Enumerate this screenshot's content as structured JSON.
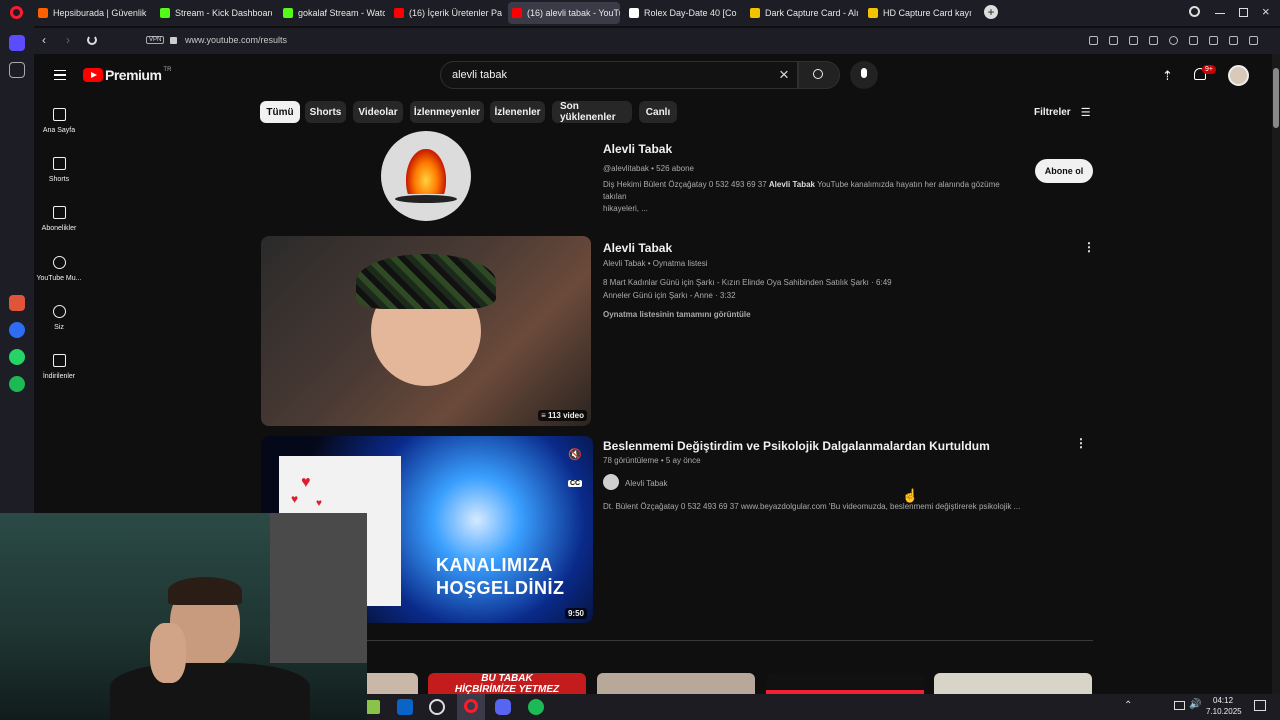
{
  "browser": {
    "tabs": [
      {
        "label": "Hepsiburada | Güvenlik",
        "color": "#ff6000"
      },
      {
        "label": "Stream - Kick Dashboard",
        "color": "#53fc18"
      },
      {
        "label": "gokalaf Stream - Watch L",
        "color": "#53fc18"
      },
      {
        "label": "(16) İçerik Üretenler Paran",
        "color": "#ff0000"
      },
      {
        "label": "(16) alevli tabak - YouTub",
        "color": "#ff0000"
      },
      {
        "label": "Rolex Day-Date 40 [Comp",
        "color": "#ffffff"
      },
      {
        "label": "Dark Capture Card - Alışv",
        "color": "#f5c400"
      },
      {
        "label": "HD Capture Card kayıt ka",
        "color": "#f5c400"
      }
    ],
    "vpn_label": "VPN",
    "url": "www.youtube.com/results"
  },
  "youtube": {
    "logo_text": "Premium",
    "logo_region": "TR",
    "search_value": "alevli tabak",
    "notification_count": "9+",
    "guide": [
      {
        "label": "Ana Sayfa",
        "icon": "home-icon"
      },
      {
        "label": "Shorts",
        "icon": "shorts-icon"
      },
      {
        "label": "Abonelikler",
        "icon": "subscriptions-icon"
      },
      {
        "label": "YouTube Mu...",
        "icon": "youtube-music-icon"
      },
      {
        "label": "Siz",
        "icon": "you-icon"
      },
      {
        "label": "İndirilenler",
        "icon": "downloads-icon"
      }
    ],
    "chips": [
      "Tümü",
      "Shorts",
      "Videolar",
      "İzlenmeyenler",
      "İzlenenler",
      "Son yüklenenler",
      "Canlı"
    ],
    "filters_label": "Filtreler",
    "channel": {
      "name": "Alevli Tabak",
      "handle": "@alevlitabak",
      "subs": "526 abone",
      "desc_prefix": "Diş Hekimi Bülent Özçağatay 0 532 493 69 37",
      "desc_bold": "Alevli Tabak",
      "desc_suffix": "YouTube kanalımızda hayatın her alanında gözüme takılan",
      "desc_line2": "hikayeleri, ...",
      "subscribe_label": "Abone ol"
    },
    "playlist": {
      "title": "Alevli Tabak",
      "channel": "Alevli Tabak",
      "type": "Oynatma listesi",
      "item1": "8 Mart Kadınlar Günü için Şarkı - Kızın Elinde Oya Sahibinden Satılık Şarkı · 6:49",
      "item2": "Anneler Günü için Şarkı - Anne · 3:32",
      "view_all": "Oynatma listesinin tamamını görüntüle",
      "count": "113 video"
    },
    "video": {
      "title": "Beslenmemi Değiştirdim ve Psikolojik Dalgalanmalardan Kurtuldum",
      "views": "78 görüntüleme",
      "age": "5 ay önce",
      "channel": "Alevli Tabak",
      "desc": "Dt. Bülent Özçağatay 0 532 493 69 37 www.beyazdolgular.com 'Bu videomuzda, beslenmemi değiştirerek psikolojik ...",
      "thumb_line1": "KANALIMIZA",
      "thumb_line2": "HOŞGELDİNİZ",
      "duration": "9:50",
      "cc_label": "CC"
    },
    "bottom_thumb_text": [
      "BU TABAK",
      "HİÇBİRİMİZE YETMEZ"
    ]
  },
  "taskbar": {
    "time": "04:12",
    "date": "7.10.2025"
  }
}
